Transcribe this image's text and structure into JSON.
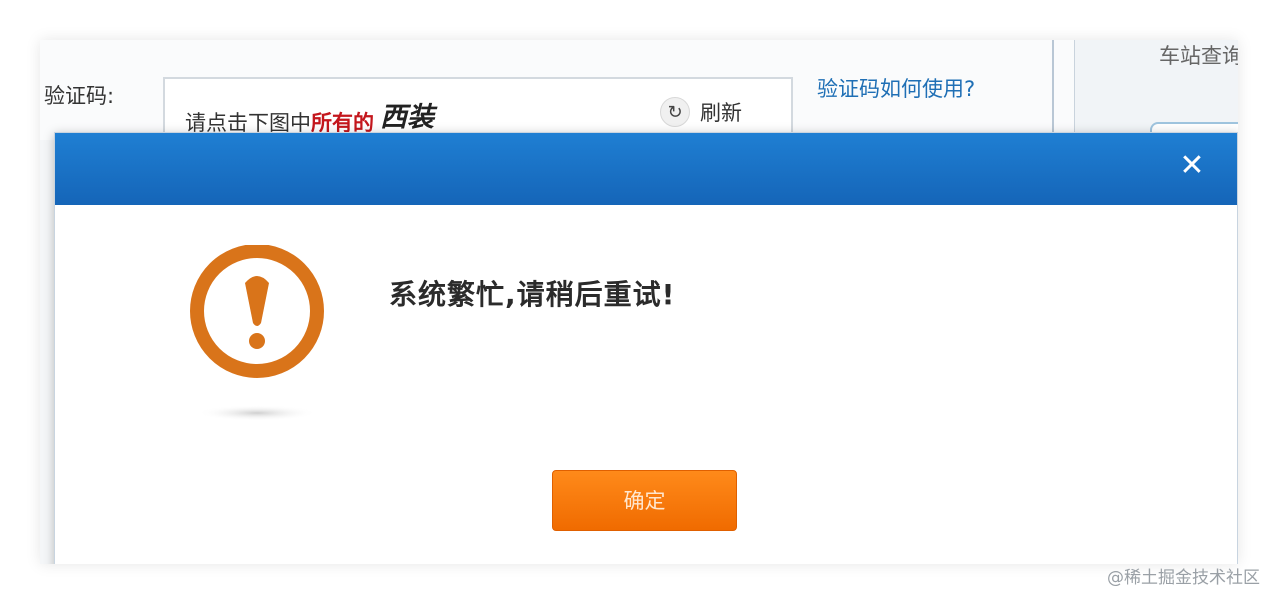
{
  "form": {
    "captcha_label": "验证码:",
    "captcha_prompt_prefix": "请点击下图中",
    "captcha_prompt_highlight": "所有的",
    "captcha_target": "西装",
    "refresh_icon": "↻",
    "refresh_label": "刷新",
    "help_link": "验证码如何使用?"
  },
  "right_panel": {
    "station_text": "车站查询"
  },
  "modal": {
    "close_symbol": "✕",
    "message": "系统繁忙,请稍后重试!",
    "confirm_label": "确定",
    "icon": "exclamation-icon"
  },
  "watermark": "@稀土掘金技术社区",
  "colors": {
    "header_blue": "#1a73c8",
    "button_orange": "#f97a0b",
    "icon_orange": "#d9741a",
    "highlight_red": "#c4161c",
    "link_blue": "#1f6fb5"
  }
}
